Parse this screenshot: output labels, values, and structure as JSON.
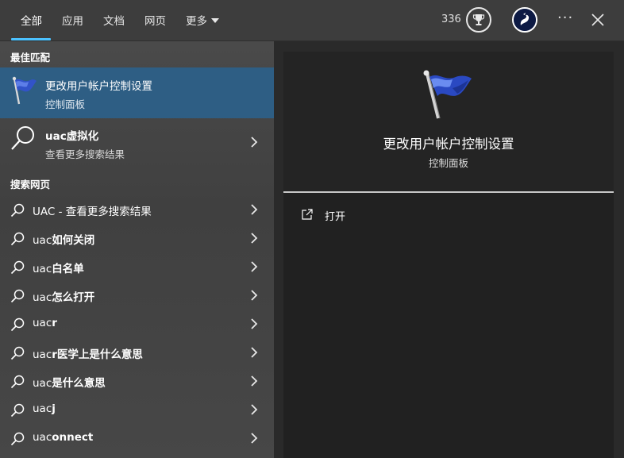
{
  "tabs": [
    "全部",
    "应用",
    "文档",
    "网页",
    "更多"
  ],
  "points": "336",
  "icons": {
    "trophy": "trophy-icon",
    "more": "more-icon",
    "close": "close-icon",
    "search": "search-icon",
    "chevron": "chevron-right-icon",
    "open": "open-icon"
  },
  "colors": {
    "accent": "#4cc2ff",
    "selected_row": "#2e5e84",
    "preview_bg": "#212121"
  },
  "best_match": {
    "section_title": "最佳匹配",
    "title": "更改用户帐户控制设置",
    "subtitle": "控制面板"
  },
  "uac_result": {
    "title": "uac虚拟化",
    "subtitle": "查看更多搜索结果"
  },
  "web_section_title": "搜索网页",
  "web_results": [
    {
      "prefix": "UAC",
      "bold": "",
      "suffix": " - 查看更多搜索结果"
    },
    {
      "prefix": "uac",
      "bold": "如何关闭",
      "suffix": ""
    },
    {
      "prefix": "uac",
      "bold": "白名单",
      "suffix": ""
    },
    {
      "prefix": "uac",
      "bold": "怎么打开",
      "suffix": ""
    },
    {
      "prefix": "uac",
      "bold": "r",
      "suffix": ""
    },
    {
      "prefix": "uac",
      "bold": "r医学上是什么意思",
      "suffix": ""
    },
    {
      "prefix": "uac",
      "bold": "是什么意思",
      "suffix": ""
    },
    {
      "prefix": "uac",
      "bold": "j",
      "suffix": ""
    },
    {
      "prefix": "uac",
      "bold": "onnect",
      "suffix": ""
    }
  ],
  "preview": {
    "title": "更改用户帐户控制设置",
    "subtitle": "控制面板",
    "action_open": "打开"
  }
}
